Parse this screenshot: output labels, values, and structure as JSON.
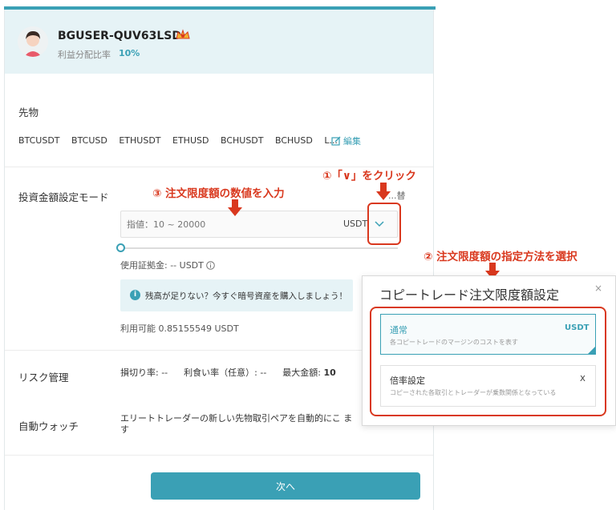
{
  "header": {
    "username": "BGUSER-QUV63LSD",
    "profit_share_label": "利益分配比率",
    "profit_share_value": "10%"
  },
  "futures": {
    "section_label": "先物",
    "pairs": [
      "BTCUSDT",
      "BTCUSD",
      "ETHUSDT",
      "ETHUSD",
      "BCHUSDT",
      "BCHUSD",
      "L..."
    ],
    "edit_label": "編集"
  },
  "investment": {
    "mode_label": "投資金額設定モード",
    "mode_right_text": "...替",
    "input_placeholder": "指値：10 ~ 20000",
    "input_unit": "USDT",
    "margin_label": "使用証拠金: -- USDT",
    "notice_text": "残高が足りない？今すぐ暗号資産を購入しましょう！",
    "available": "利用可能 0.85155549 USDT"
  },
  "risk": {
    "label": "リスク管理",
    "stop_loss": "損切り率: --",
    "take_profit": "利食い率（任意）: --",
    "max_amount_label": "最大金額:",
    "max_amount_value": "10"
  },
  "auto_watch": {
    "label": "自動ウォッチ",
    "text": "エリートトレーダーの新しい先物取引ペアを自動的にこ ます"
  },
  "next_button": "次へ",
  "annotations": {
    "step1": "①「∨」をクリック",
    "step2": "② 注文限度額の指定方法を選択",
    "step3": "③ 注文限度額の数値を入力"
  },
  "popup": {
    "title": "コピートレード注文限度額設定",
    "close": "×",
    "options": [
      {
        "title": "通常",
        "unit": "USDT",
        "desc": "各コピートレードのマージンのコストを表す",
        "selected": true
      },
      {
        "title": "倍率設定",
        "unit": "X",
        "desc": "コピーされた各取引とトレーダーが乗数関係となっている",
        "selected": false
      }
    ]
  },
  "colors": {
    "accent": "#3aa0b5",
    "annotation_red": "#d9381e",
    "header_bg": "#e6f3f6"
  }
}
